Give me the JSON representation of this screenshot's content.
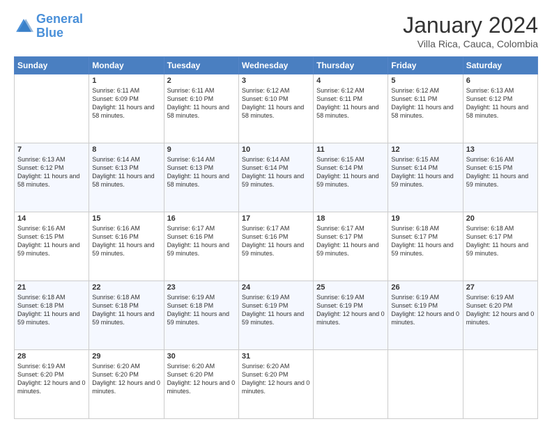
{
  "logo": {
    "line1": "General",
    "line2": "Blue"
  },
  "header": {
    "month": "January 2024",
    "location": "Villa Rica, Cauca, Colombia"
  },
  "weekdays": [
    "Sunday",
    "Monday",
    "Tuesday",
    "Wednesday",
    "Thursday",
    "Friday",
    "Saturday"
  ],
  "weeks": [
    [
      {
        "day": "",
        "sunrise": "",
        "sunset": "",
        "daylight": ""
      },
      {
        "day": "1",
        "sunrise": "Sunrise: 6:11 AM",
        "sunset": "Sunset: 6:09 PM",
        "daylight": "Daylight: 11 hours and 58 minutes."
      },
      {
        "day": "2",
        "sunrise": "Sunrise: 6:11 AM",
        "sunset": "Sunset: 6:10 PM",
        "daylight": "Daylight: 11 hours and 58 minutes."
      },
      {
        "day": "3",
        "sunrise": "Sunrise: 6:12 AM",
        "sunset": "Sunset: 6:10 PM",
        "daylight": "Daylight: 11 hours and 58 minutes."
      },
      {
        "day": "4",
        "sunrise": "Sunrise: 6:12 AM",
        "sunset": "Sunset: 6:11 PM",
        "daylight": "Daylight: 11 hours and 58 minutes."
      },
      {
        "day": "5",
        "sunrise": "Sunrise: 6:12 AM",
        "sunset": "Sunset: 6:11 PM",
        "daylight": "Daylight: 11 hours and 58 minutes."
      },
      {
        "day": "6",
        "sunrise": "Sunrise: 6:13 AM",
        "sunset": "Sunset: 6:12 PM",
        "daylight": "Daylight: 11 hours and 58 minutes."
      }
    ],
    [
      {
        "day": "7",
        "sunrise": "Sunrise: 6:13 AM",
        "sunset": "Sunset: 6:12 PM",
        "daylight": "Daylight: 11 hours and 58 minutes."
      },
      {
        "day": "8",
        "sunrise": "Sunrise: 6:14 AM",
        "sunset": "Sunset: 6:13 PM",
        "daylight": "Daylight: 11 hours and 58 minutes."
      },
      {
        "day": "9",
        "sunrise": "Sunrise: 6:14 AM",
        "sunset": "Sunset: 6:13 PM",
        "daylight": "Daylight: 11 hours and 58 minutes."
      },
      {
        "day": "10",
        "sunrise": "Sunrise: 6:14 AM",
        "sunset": "Sunset: 6:14 PM",
        "daylight": "Daylight: 11 hours and 59 minutes."
      },
      {
        "day": "11",
        "sunrise": "Sunrise: 6:15 AM",
        "sunset": "Sunset: 6:14 PM",
        "daylight": "Daylight: 11 hours and 59 minutes."
      },
      {
        "day": "12",
        "sunrise": "Sunrise: 6:15 AM",
        "sunset": "Sunset: 6:14 PM",
        "daylight": "Daylight: 11 hours and 59 minutes."
      },
      {
        "day": "13",
        "sunrise": "Sunrise: 6:16 AM",
        "sunset": "Sunset: 6:15 PM",
        "daylight": "Daylight: 11 hours and 59 minutes."
      }
    ],
    [
      {
        "day": "14",
        "sunrise": "Sunrise: 6:16 AM",
        "sunset": "Sunset: 6:15 PM",
        "daylight": "Daylight: 11 hours and 59 minutes."
      },
      {
        "day": "15",
        "sunrise": "Sunrise: 6:16 AM",
        "sunset": "Sunset: 6:16 PM",
        "daylight": "Daylight: 11 hours and 59 minutes."
      },
      {
        "day": "16",
        "sunrise": "Sunrise: 6:17 AM",
        "sunset": "Sunset: 6:16 PM",
        "daylight": "Daylight: 11 hours and 59 minutes."
      },
      {
        "day": "17",
        "sunrise": "Sunrise: 6:17 AM",
        "sunset": "Sunset: 6:16 PM",
        "daylight": "Daylight: 11 hours and 59 minutes."
      },
      {
        "day": "18",
        "sunrise": "Sunrise: 6:17 AM",
        "sunset": "Sunset: 6:17 PM",
        "daylight": "Daylight: 11 hours and 59 minutes."
      },
      {
        "day": "19",
        "sunrise": "Sunrise: 6:18 AM",
        "sunset": "Sunset: 6:17 PM",
        "daylight": "Daylight: 11 hours and 59 minutes."
      },
      {
        "day": "20",
        "sunrise": "Sunrise: 6:18 AM",
        "sunset": "Sunset: 6:17 PM",
        "daylight": "Daylight: 11 hours and 59 minutes."
      }
    ],
    [
      {
        "day": "21",
        "sunrise": "Sunrise: 6:18 AM",
        "sunset": "Sunset: 6:18 PM",
        "daylight": "Daylight: 11 hours and 59 minutes."
      },
      {
        "day": "22",
        "sunrise": "Sunrise: 6:18 AM",
        "sunset": "Sunset: 6:18 PM",
        "daylight": "Daylight: 11 hours and 59 minutes."
      },
      {
        "day": "23",
        "sunrise": "Sunrise: 6:19 AM",
        "sunset": "Sunset: 6:18 PM",
        "daylight": "Daylight: 11 hours and 59 minutes."
      },
      {
        "day": "24",
        "sunrise": "Sunrise: 6:19 AM",
        "sunset": "Sunset: 6:19 PM",
        "daylight": "Daylight: 11 hours and 59 minutes."
      },
      {
        "day": "25",
        "sunrise": "Sunrise: 6:19 AM",
        "sunset": "Sunset: 6:19 PM",
        "daylight": "Daylight: 12 hours and 0 minutes."
      },
      {
        "day": "26",
        "sunrise": "Sunrise: 6:19 AM",
        "sunset": "Sunset: 6:19 PM",
        "daylight": "Daylight: 12 hours and 0 minutes."
      },
      {
        "day": "27",
        "sunrise": "Sunrise: 6:19 AM",
        "sunset": "Sunset: 6:20 PM",
        "daylight": "Daylight: 12 hours and 0 minutes."
      }
    ],
    [
      {
        "day": "28",
        "sunrise": "Sunrise: 6:19 AM",
        "sunset": "Sunset: 6:20 PM",
        "daylight": "Daylight: 12 hours and 0 minutes."
      },
      {
        "day": "29",
        "sunrise": "Sunrise: 6:20 AM",
        "sunset": "Sunset: 6:20 PM",
        "daylight": "Daylight: 12 hours and 0 minutes."
      },
      {
        "day": "30",
        "sunrise": "Sunrise: 6:20 AM",
        "sunset": "Sunset: 6:20 PM",
        "daylight": "Daylight: 12 hours and 0 minutes."
      },
      {
        "day": "31",
        "sunrise": "Sunrise: 6:20 AM",
        "sunset": "Sunset: 6:20 PM",
        "daylight": "Daylight: 12 hours and 0 minutes."
      },
      {
        "day": "",
        "sunrise": "",
        "sunset": "",
        "daylight": ""
      },
      {
        "day": "",
        "sunrise": "",
        "sunset": "",
        "daylight": ""
      },
      {
        "day": "",
        "sunrise": "",
        "sunset": "",
        "daylight": ""
      }
    ]
  ]
}
